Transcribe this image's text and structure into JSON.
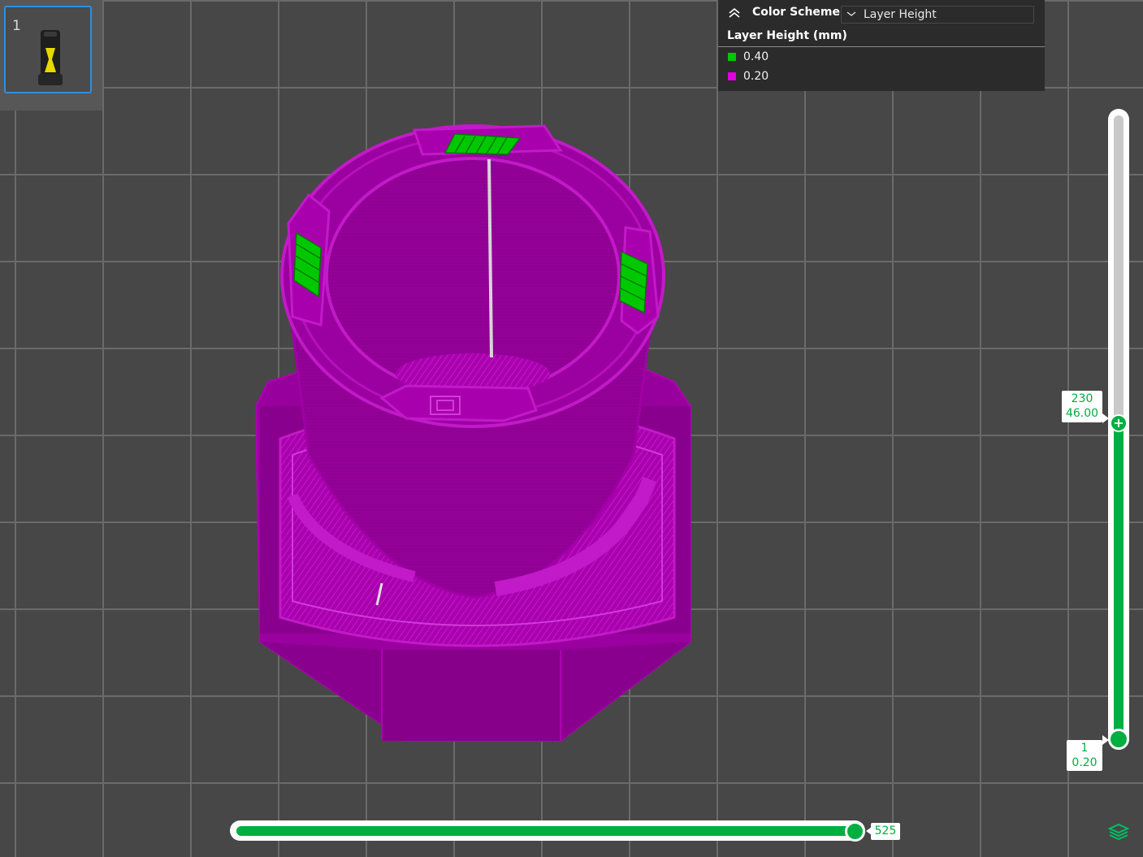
{
  "plate": {
    "number": "1"
  },
  "legend": {
    "color_scheme_label": "Color Scheme",
    "color_scheme_value": "Layer Height",
    "title": "Layer Height (mm)",
    "items": [
      {
        "label": "0.40",
        "color": "#00c800"
      },
      {
        "label": "0.20",
        "color": "#e000e0"
      }
    ]
  },
  "layer_slider": {
    "top_layer": "230",
    "top_height": "46.00",
    "bottom_layer": "1",
    "bottom_height": "0.20",
    "accent": "#00ae42"
  },
  "move_slider": {
    "value": "525"
  },
  "model": {
    "primary_color": "#8b008b",
    "wall_color": "#a300a8",
    "infill_color": "#00c800"
  }
}
